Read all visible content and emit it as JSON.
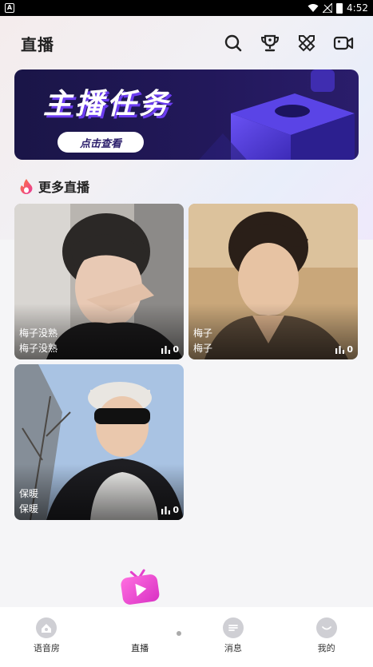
{
  "status_bar": {
    "time": "4:52",
    "app_badge": "A"
  },
  "header": {
    "title": "直播"
  },
  "banner": {
    "title": "主播任务",
    "cta": "点击查看"
  },
  "section": {
    "title": "更多直播"
  },
  "cards": [
    {
      "name": "梅子没熟",
      "subtitle": "梅子没熟",
      "viewers": "0"
    },
    {
      "name": "梅子",
      "subtitle": "梅子",
      "viewers": "0"
    },
    {
      "name": "保暖",
      "subtitle": "保暖",
      "viewers": "0"
    }
  ],
  "tabbar": {
    "items": [
      {
        "label": "语音房"
      },
      {
        "label": "直播"
      },
      {
        "label": "消息"
      },
      {
        "label": "我的"
      }
    ]
  },
  "colors": {
    "accent": "#f24dd6",
    "banner_bg": "#1a1547",
    "banner_shadow": "#6b3cf0"
  }
}
